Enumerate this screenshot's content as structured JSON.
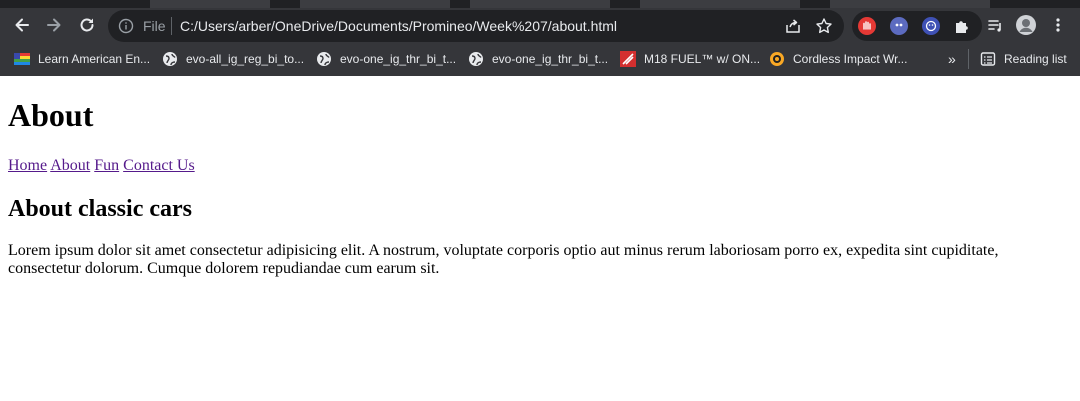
{
  "browser": {
    "omnibox": {
      "scheme_label": "File",
      "url": "C:/Users/arber/OneDrive/Documents/Promineo/Week%207/about.html"
    },
    "bookmarks": [
      {
        "label": "Learn American En...",
        "icon": "flag-icon"
      },
      {
        "label": "evo-all_ig_reg_bi_to...",
        "icon": "globe-icon"
      },
      {
        "label": "evo-one_ig_thr_bi_t...",
        "icon": "globe-icon"
      },
      {
        "label": "evo-one_ig_thr_bi_t...",
        "icon": "globe-icon"
      },
      {
        "label": "M18 FUEL™ w/ ON...",
        "icon": "milwaukee-icon"
      },
      {
        "label": "Cordless Impact Wr...",
        "icon": "badge-icon"
      }
    ],
    "bookmarks_overflow": "»",
    "reading_list": "Reading list",
    "colors": {
      "chrome": "#35363a",
      "omnibox": "#202124",
      "text": "#e8eaed",
      "muted": "#9aa0a6"
    }
  },
  "page": {
    "title": "About",
    "nav": [
      "Home",
      "About",
      "Fun",
      "Contact Us"
    ],
    "section_heading": "About classic cars",
    "paragraph": "Lorem ipsum dolor sit amet consectetur adipisicing elit. A nostrum, voluptate corporis optio aut minus rerum laboriosam porro ex, expedita sint cupiditate, consectetur dolorum. Cumque dolorem repudiandae cum earum sit.",
    "colors": {
      "link": "#551a8b",
      "text": "#000000",
      "background": "#ffffff"
    }
  }
}
